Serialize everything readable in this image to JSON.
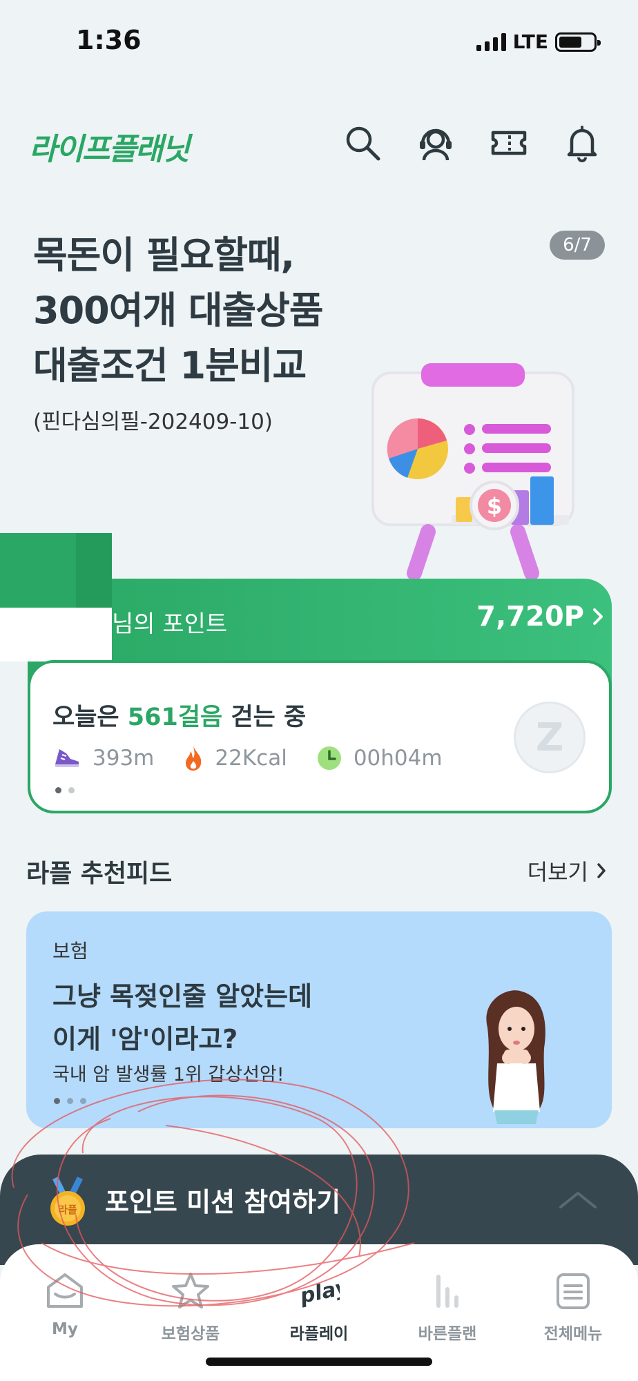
{
  "status_bar": {
    "time": "1:36",
    "network": "LTE"
  },
  "header": {
    "logo": "라이프플래닛",
    "icons": [
      "search-icon",
      "headset-icon",
      "ticket-icon",
      "bell-icon"
    ]
  },
  "banner": {
    "title_lines": [
      "목돈이 필요할때,",
      "300여개 대출상품",
      "대출조건 1분비교"
    ],
    "sub": "(핀다심의필-202409-10)",
    "pager": "6/7"
  },
  "points": {
    "label": "님의 포인트",
    "value": "7,720P"
  },
  "walk": {
    "prefix": "오늘은 ",
    "steps": "561걸음",
    "suffix": " 걷는 중",
    "distance": "393m",
    "kcal": "22Kcal",
    "time": "00h04m",
    "coin_glyph": "Z"
  },
  "feed": {
    "title": "라플 추천피드",
    "more": "더보기",
    "card": {
      "category": "보험",
      "headline_1": "그냥 목젖인줄 알았는데",
      "headline_2": "이게 '암'이라고?",
      "desc": "국내 암 발생률 1위 갑상선암!"
    }
  },
  "mission": {
    "label": "포인트 미션 참여하기",
    "medal_text": "라플"
  },
  "tabs": [
    {
      "label": "My",
      "icon": "mail-home-icon"
    },
    {
      "label": "보험상품",
      "icon": "star-icon"
    },
    {
      "label": "라플레이",
      "icon": "play-logo-icon"
    },
    {
      "label": "바른플랜",
      "icon": "bars-icon"
    },
    {
      "label": "전체메뉴",
      "icon": "menu-icon"
    }
  ],
  "colors": {
    "brand_green": "#2aa764",
    "feed_card": "#b4dafc",
    "mission_bar": "#37474f"
  }
}
